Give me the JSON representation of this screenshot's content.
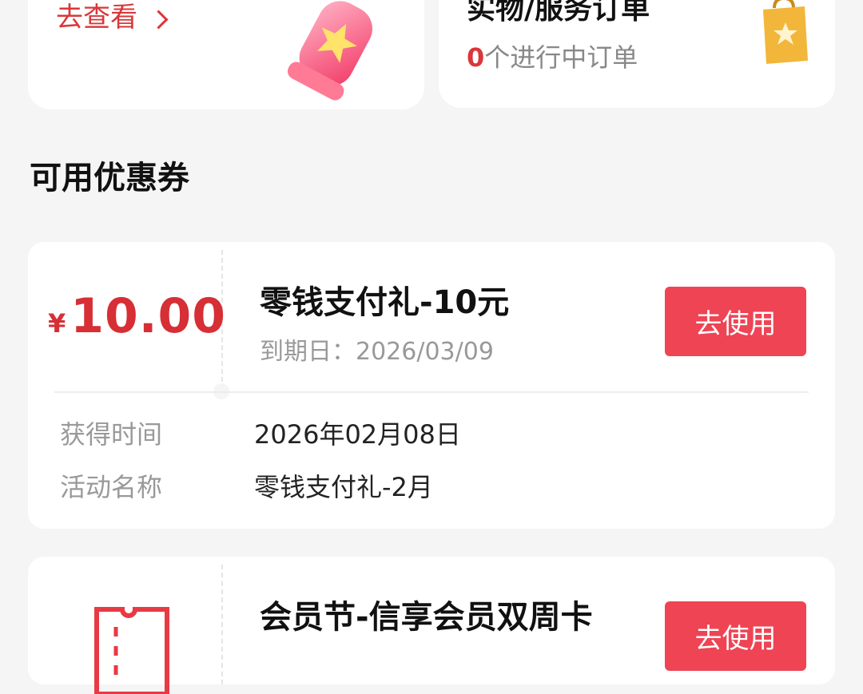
{
  "top": {
    "view_label": "去查看",
    "order_title": "实物/服务订单",
    "order_count": "0",
    "order_suffix": "个进行中订单"
  },
  "section": {
    "title": "可用优惠券"
  },
  "coupons": [
    {
      "currency": "¥",
      "amount": "10.00",
      "name": "零钱支付礼-10元",
      "expiry": "到期日：2026/03/09",
      "button": "去使用",
      "info": [
        {
          "label": "获得时间",
          "value": "2026年02月08日"
        },
        {
          "label": "活动名称",
          "value": "零钱支付礼-2月"
        }
      ]
    },
    {
      "name": "会员节-信享会员双周卡",
      "button": "去使用",
      "icon": "ticket-icon"
    }
  ],
  "colors": {
    "accent": "#d9373a",
    "button": "#ee4454",
    "background": "#f5f5f5"
  }
}
